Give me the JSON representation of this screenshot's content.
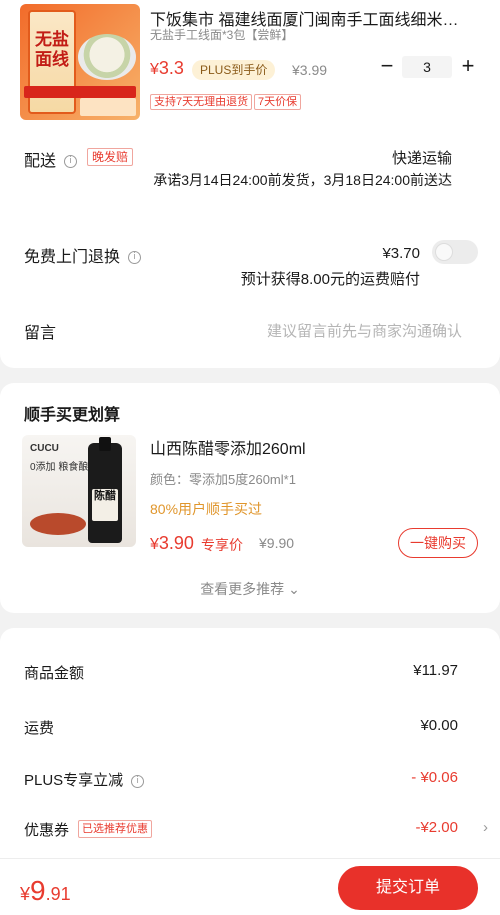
{
  "product": {
    "thumb_text": "无盐面线",
    "title": "下饭集市 福建线面厦门闽南手工面线细米…",
    "spec": "无盐手工线面*3包【尝鲜】",
    "price_symbol": "¥",
    "price_value": "3.3",
    "plus_label": "PLUS到手价",
    "orig_price": "¥3.99",
    "qty_minus": "−",
    "qty": "3",
    "qty_plus": "+",
    "service_tags": [
      "支持7天无理由退货",
      "7天价保"
    ]
  },
  "delivery": {
    "label": "配送",
    "info_icon": "i",
    "late_badge": "晚发赔",
    "method": "快递运输",
    "promise": "承诺3月14日24:00前发货，3月18日24:00前送达"
  },
  "free_return": {
    "label": "免费上门退换",
    "info_icon": "i",
    "price": "¥3.70",
    "note": "预计获得8.00元的运费赔付",
    "enabled": false
  },
  "message": {
    "label": "留言",
    "placeholder": "建议留言前先与商家沟通确认"
  },
  "recommend": {
    "heading": "顺手买更划算",
    "thumb_brand": "CUCU",
    "thumb_text": "0添加 粮食酿造",
    "bottle_label": "陈醋",
    "name": "山西陈醋零添加260ml",
    "spec": "颜色：零添加5度260ml*1",
    "percent": "80%用户顺手买过",
    "price_symbol": "¥",
    "price_value": "3.90",
    "exclusive": "专享价",
    "orig_price": "¥9.90",
    "buy_button": "一键购买",
    "more": "查看更多推荐 ⌄"
  },
  "summary": {
    "goods_label": "商品金额",
    "goods_value": "¥11.97",
    "shipping_label": "运费",
    "shipping_value": "¥0.00",
    "plus_label": "PLUS专享立减",
    "plus_info_icon": "i",
    "plus_value": "- ¥0.06",
    "coupon_label": "优惠券",
    "coupon_badge": "已选推荐优惠",
    "coupon_value": "-¥2.00",
    "chevron": "›"
  },
  "bottom": {
    "total_symbol": "¥",
    "total_value": "9",
    "total_decimal": ".91",
    "submit": "提交订单"
  },
  "colors": {
    "accent": "#e83b2f",
    "plus_bg": "#fdf1d6",
    "orange_text": "#e0962c"
  }
}
